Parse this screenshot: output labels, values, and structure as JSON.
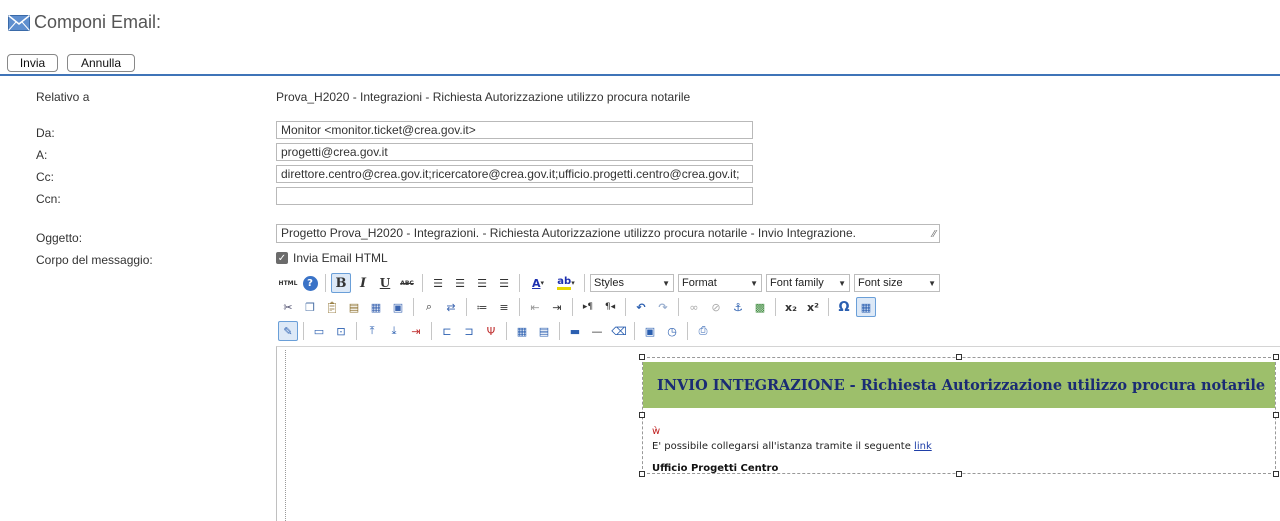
{
  "header": {
    "title": "Componi Email:",
    "icon": "envelope-icon"
  },
  "actions": {
    "send_label": "Invia",
    "cancel_label": "Annulla"
  },
  "form": {
    "related_label": "Relativo a",
    "related_value": "Prova_H2020 - Integrazioni - Richiesta Autorizzazione utilizzo procura notarile",
    "from_label": "Da:",
    "from_value": "Monitor  <monitor.ticket@crea.gov.it>",
    "to_label": "A:",
    "to_value": "progetti@crea.gov.it",
    "cc_label": "Cc:",
    "cc_value": "direttore.centro@crea.gov.it;ricercatore@crea.gov.it;ufficio.progetti.centro@crea.gov.it;",
    "bcc_label": "Ccn:",
    "bcc_value": "",
    "subject_label": "Oggetto:",
    "subject_value": "Progetto Prova_H2020 - Integrazioni. - Richiesta Autorizzazione utilizzo procura notarile  - Invio Integrazione.",
    "body_label": "Corpo del messaggio:",
    "html_checkbox_label": "Invia Email HTML",
    "html_checkbox_checked": true
  },
  "toolbar": {
    "html_label": "HTML",
    "bold": "B",
    "italic": "I",
    "underline": "U",
    "strike": "ABC",
    "styles_label": "Styles",
    "format_label": "Format",
    "font_family_label": "Font family",
    "font_size_label": "Font size",
    "subscript": "x₂",
    "superscript": "x²",
    "omega": "Ω"
  },
  "editor": {
    "banner_text": "INVIO INTEGRAZIONE - Richiesta Autorizzazione utilizzo procura notarile",
    "marker_text": "ẁ",
    "link_sentence": "E' possibile collegarsi all'istanza tramite il seguente ",
    "link_text": "link",
    "signature": "Ufficio Progetti Centro"
  },
  "colors": {
    "accent": "#3f74b8",
    "banner_bg": "#9dbf6b",
    "banner_text": "#1a2b74",
    "link": "#1f3fa8"
  }
}
